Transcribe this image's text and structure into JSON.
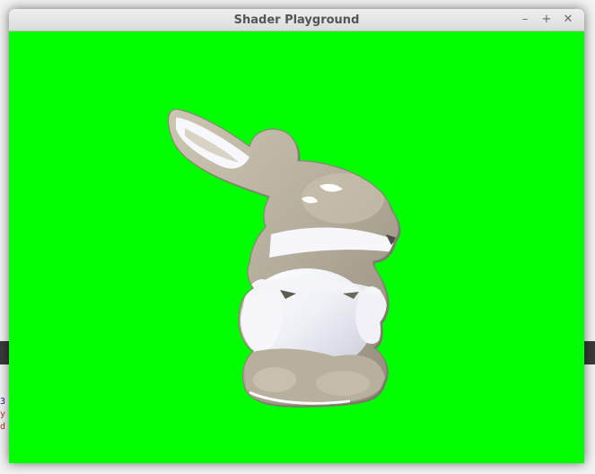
{
  "window": {
    "title": "Shader Playground",
    "viewport_background": "#00ff00",
    "controls": {
      "minimize_glyph": "–",
      "maximize_glyph": "+",
      "close_glyph": "✕"
    }
  },
  "scene": {
    "object": "bunny-model",
    "material_colors": [
      "#b9b09e",
      "#ffffff",
      "#8f8778"
    ]
  },
  "background_window_text": {
    "line1": "3",
    "line2": "y",
    "line3": "d"
  }
}
